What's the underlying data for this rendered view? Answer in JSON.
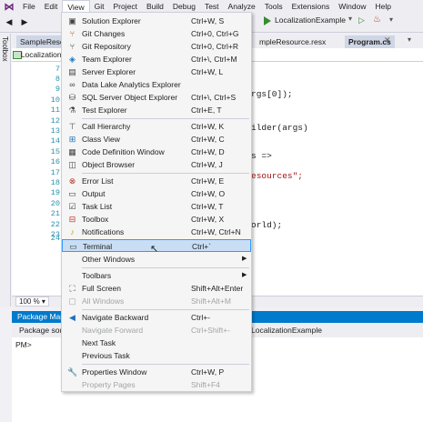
{
  "menubar": {
    "items": [
      "File",
      "Edit",
      "View",
      "Git",
      "Project",
      "Build",
      "Debug",
      "Test",
      "Analyze",
      "Tools",
      "Extensions",
      "Window",
      "Help"
    ],
    "active": "View"
  },
  "toolbar": {
    "run_target": "LocalizationExample",
    "dropdown_glyph": "▾"
  },
  "toolbox": {
    "label": "Toolbox"
  },
  "tabs": {
    "sample_resource": "SampleResou",
    "sample_resource_resx": "mpleResource.resx",
    "program_cs": "Program.cs"
  },
  "nav": {
    "combo": "Localization"
  },
  "editor": {
    "line_numbers": [
      "7",
      "8",
      "9",
      "10",
      "11",
      "12",
      "13",
      "14",
      "15",
      "16",
      "17",
      "18",
      "19",
      "20",
      "21",
      "22",
      "23",
      "24"
    ],
    "fragments": [
      "rgs[0]);",
      "ilder(args)",
      "s =>",
      "esources\";",
      "orld);"
    ],
    "zoom": "100 %"
  },
  "package_manager": {
    "title": "Package Mana",
    "source_label": "Package sourc",
    "project": "LocalizationExample",
    "prompt": "PM>"
  },
  "view_menu": {
    "items": [
      {
        "icon": "solution-explorer-icon",
        "label": "Solution Explorer",
        "shortcut": "Ctrl+W, S"
      },
      {
        "icon": "git-changes-icon",
        "label": "Git Changes",
        "shortcut": "Ctrl+0, Ctrl+G"
      },
      {
        "icon": "git-repository-icon",
        "label": "Git Repository",
        "shortcut": "Ctrl+0, Ctrl+R"
      },
      {
        "icon": "team-explorer-icon",
        "label": "Team Explorer",
        "shortcut": "Ctrl+\\, Ctrl+M"
      },
      {
        "icon": "server-explorer-icon",
        "label": "Server Explorer",
        "shortcut": "Ctrl+W, L"
      },
      {
        "icon": "data-lake-icon",
        "label": "Data Lake Analytics Explorer",
        "shortcut": ""
      },
      {
        "icon": "sql-server-icon",
        "label": "SQL Server Object Explorer",
        "shortcut": "Ctrl+\\, Ctrl+S"
      },
      {
        "icon": "test-explorer-icon",
        "label": "Test Explorer",
        "shortcut": "Ctrl+E, T"
      },
      {
        "icon": "call-hierarchy-icon",
        "label": "Call Hierarchy",
        "shortcut": "Ctrl+W, K"
      },
      {
        "icon": "class-view-icon",
        "label": "Class View",
        "shortcut": "Ctrl+W, C"
      },
      {
        "icon": "code-definition-icon",
        "label": "Code Definition Window",
        "shortcut": "Ctrl+W, D"
      },
      {
        "icon": "object-browser-icon",
        "label": "Object Browser",
        "shortcut": "Ctrl+W, J"
      },
      {
        "icon": "error-list-icon",
        "label": "Error List",
        "shortcut": "Ctrl+W, E"
      },
      {
        "icon": "output-icon",
        "label": "Output",
        "shortcut": "Ctrl+W, O"
      },
      {
        "icon": "task-list-icon",
        "label": "Task List",
        "shortcut": "Ctrl+W, T"
      },
      {
        "icon": "toolbox-icon",
        "label": "Toolbox",
        "shortcut": "Ctrl+W, X"
      },
      {
        "icon": "notifications-icon",
        "label": "Notifications",
        "shortcut": "Ctrl+W, Ctrl+N"
      },
      {
        "icon": "terminal-icon",
        "label": "Terminal",
        "shortcut": "Ctrl+`"
      },
      {
        "icon": "",
        "label": "Other Windows",
        "shortcut": ""
      },
      {
        "icon": "",
        "label": "Toolbars",
        "shortcut": ""
      },
      {
        "icon": "full-screen-icon",
        "label": "Full Screen",
        "shortcut": "Shift+Alt+Enter"
      },
      {
        "icon": "all-windows-icon",
        "label": "All Windows",
        "shortcut": "Shift+Alt+M"
      },
      {
        "icon": "navigate-backward-icon",
        "label": "Navigate Backward",
        "shortcut": "Ctrl+-"
      },
      {
        "icon": "",
        "label": "Navigate Forward",
        "shortcut": "Ctrl+Shift+-"
      },
      {
        "icon": "",
        "label": "Next Task",
        "shortcut": ""
      },
      {
        "icon": "",
        "label": "Previous Task",
        "shortcut": ""
      },
      {
        "icon": "properties-window-icon",
        "label": "Properties Window",
        "shortcut": "Ctrl+W, P"
      },
      {
        "icon": "",
        "label": "Property Pages",
        "shortcut": "Shift+F4"
      }
    ],
    "highlighted": "Terminal",
    "disabled": [
      "All Windows",
      "Navigate Forward",
      "Property Pages"
    ],
    "submenu": [
      "Other Windows",
      "Toolbars"
    ]
  }
}
